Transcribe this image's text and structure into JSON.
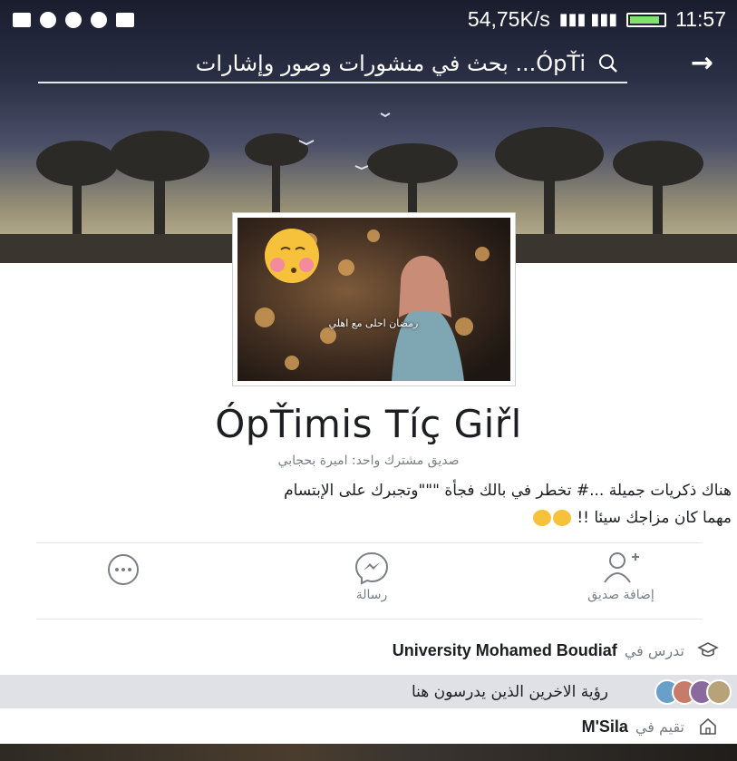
{
  "status_bar": {
    "speed": "54,75K/s",
    "time": "11:57"
  },
  "search": {
    "placeholder": "بحث في منشورات وصور وإشارات ...ÓpŤi",
    "back_icon": "arrow-right-icon",
    "search_icon": "search-icon"
  },
  "profile": {
    "avatar_caption": "رمضان احلى مع اهلي",
    "name": "ÓpŤimis Tíç Giřl",
    "mutual_friend": "صديق مشترك واحد: اميرة بحجابي",
    "bio_line1": "هناك ذكريات جميلة ...# تخطر في بالك فجأة \"\"\"وتجبرك على الإبتسام",
    "bio_line2": "مهما كان مزاجك سيئا !!"
  },
  "actions": {
    "add_friend": "إضافة صديق",
    "message": "رسالة",
    "more_icon": "more-icon"
  },
  "about": {
    "study_prefix": "تدرس في",
    "study_place": "University Mohamed Boudiaf",
    "classmates": "رؤية الاخرين الذين يدرسون هنا",
    "lives_prefix": "تقيم في",
    "lives_place": "M'Sila"
  },
  "colors": {
    "accent_gray": "#7a7f87",
    "highlight_row": "#dfe1e6"
  }
}
